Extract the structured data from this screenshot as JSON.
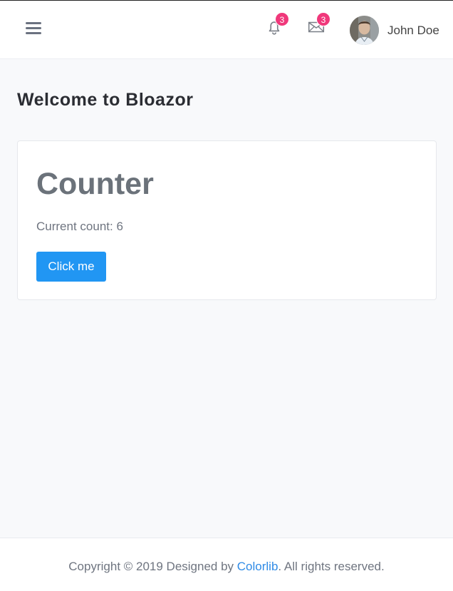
{
  "header": {
    "notifications_count": "3",
    "messages_count": "3",
    "user_name": "John Doe"
  },
  "page": {
    "title": "Welcome to Bloazor"
  },
  "card": {
    "title": "Counter",
    "count_label": "Current count: 6",
    "button_label": "Click me"
  },
  "footer": {
    "prefix": "Copyright © 2019 Designed by ",
    "link_text": "Colorlib",
    "suffix": ". All rights reserved."
  },
  "colors": {
    "accent": "#2196f3",
    "badge": "#f0387b",
    "link": "#2f8be6"
  },
  "icons": [
    "hamburger-menu-icon",
    "bell-icon",
    "mail-icon",
    "avatar-image"
  ]
}
